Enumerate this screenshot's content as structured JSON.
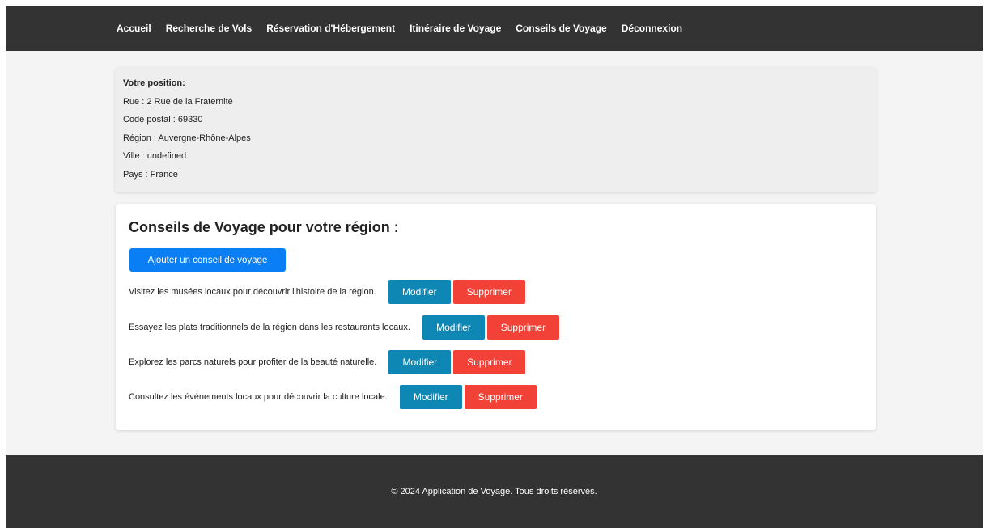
{
  "nav": {
    "items": [
      {
        "label": "Accueil"
      },
      {
        "label": "Recherche de Vols"
      },
      {
        "label": "Réservation d'Hébergement"
      },
      {
        "label": "Itinéraire de Voyage"
      },
      {
        "label": "Conseils de Voyage"
      },
      {
        "label": "Déconnexion"
      }
    ]
  },
  "location": {
    "title": "Votre position:",
    "lines": [
      "Rue : 2 Rue de la Fraternité",
      "Code postal : 69330",
      "Région : Auvergne-Rhône-Alpes",
      "Ville : undefined",
      "Pays : France"
    ]
  },
  "tips": {
    "title": "Conseils de Voyage pour votre région :",
    "add_label": "Ajouter un conseil de voyage",
    "edit_label": "Modifier",
    "delete_label": "Supprimer",
    "items": [
      {
        "text": "Visitez les musées locaux pour découvrir l'histoire de la région."
      },
      {
        "text": "Essayez les plats traditionnels de la région dans les restaurants locaux."
      },
      {
        "text": "Explorez les parcs naturels pour profiter de la beauté naturelle."
      },
      {
        "text": "Consultez les événements locaux pour découvrir la culture locale."
      }
    ]
  },
  "footer": {
    "text": "© 2024 Application de Voyage. Tous droits réservés."
  },
  "colors": {
    "navbar": "#333333",
    "primary_button": "#0a7ef5",
    "edit_button": "#0f87b5",
    "delete_button": "#f24238"
  }
}
